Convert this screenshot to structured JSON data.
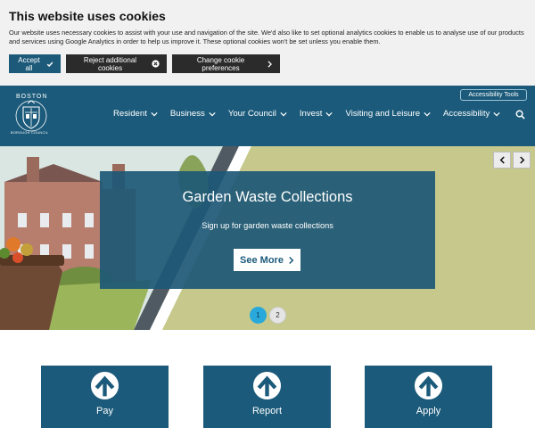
{
  "cookie_banner": {
    "title": "This website uses cookies",
    "text": "Our website uses necessary cookies to assist with your use and navigation of the site. We'd also like to set optional analytics cookies to enable us to analyse use of our products and services using Google Analytics in order to help us improve it. These optional cookies won't be set unless you enable them.",
    "accept_label": "Accept all",
    "reject_label": "Reject additional cookies",
    "change_label": "Change cookie preferences"
  },
  "header": {
    "logo_top": "BOSTON",
    "logo_bottom": "BOROUGH COUNCIL",
    "accessibility_tools": "Accessibility Tools",
    "nav": [
      "Resident",
      "Business",
      "Your Council",
      "Invest",
      "Visiting and Leisure",
      "Accessibility"
    ]
  },
  "hero": {
    "title": "Garden Waste Collections",
    "subtitle": "Sign up for garden waste collections",
    "cta_label": "See More",
    "pagination": [
      "1",
      "2"
    ],
    "active_page": "1"
  },
  "tiles": [
    "Pay",
    "Report",
    "Apply"
  ],
  "colors": {
    "brand": "#1b5a7a",
    "dot_active": "#29a9db",
    "hero_bg": "#c6c98b"
  },
  "icons": {
    "accept": "check-icon",
    "reject": "close-circle-icon",
    "change": "chevron-right-icon",
    "nav": "chevron-down-icon",
    "search": "search-icon",
    "tile": "arrow-up-circle-icon"
  }
}
